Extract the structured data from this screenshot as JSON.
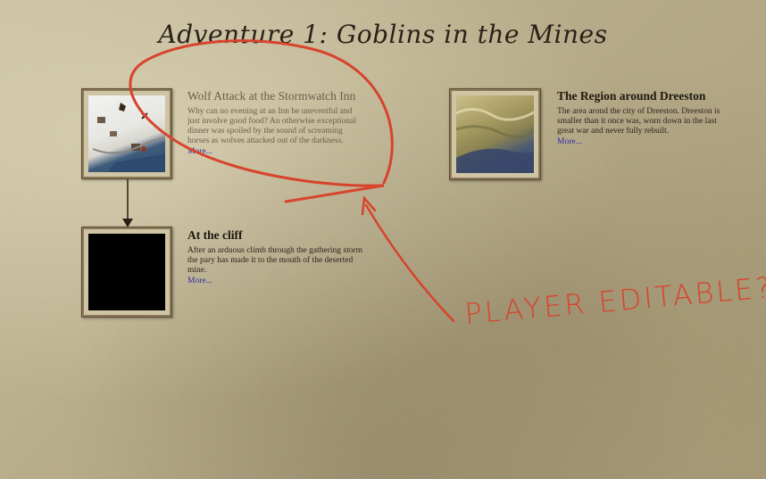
{
  "page": {
    "title": "Adventure 1: Goblins in the Mines"
  },
  "cards": [
    {
      "title": "Wolf Attack at the Stormwatch Inn",
      "description": "Why can no evening at an Inn be uneventful and just involve good food? An otherwise exceptional dinner was spoiled by the sound of screaming horses as wolves attacked out of the darkness.",
      "more": "More..."
    },
    {
      "title": "The Region around Dreeston",
      "description": "The area arond the city of Dreeston. Dreeston is smaller than it once was, worn down in the last great war and never fully rebuilt.",
      "more": "More..."
    },
    {
      "title": "At the cliff",
      "description": "After an arduous climb through the gathering storm the pary has made it to the mouth of the deserted mine.",
      "more": "More..."
    }
  ],
  "annotation": {
    "text": "PLAYER EDITABLE?",
    "color": "#d8432c"
  }
}
